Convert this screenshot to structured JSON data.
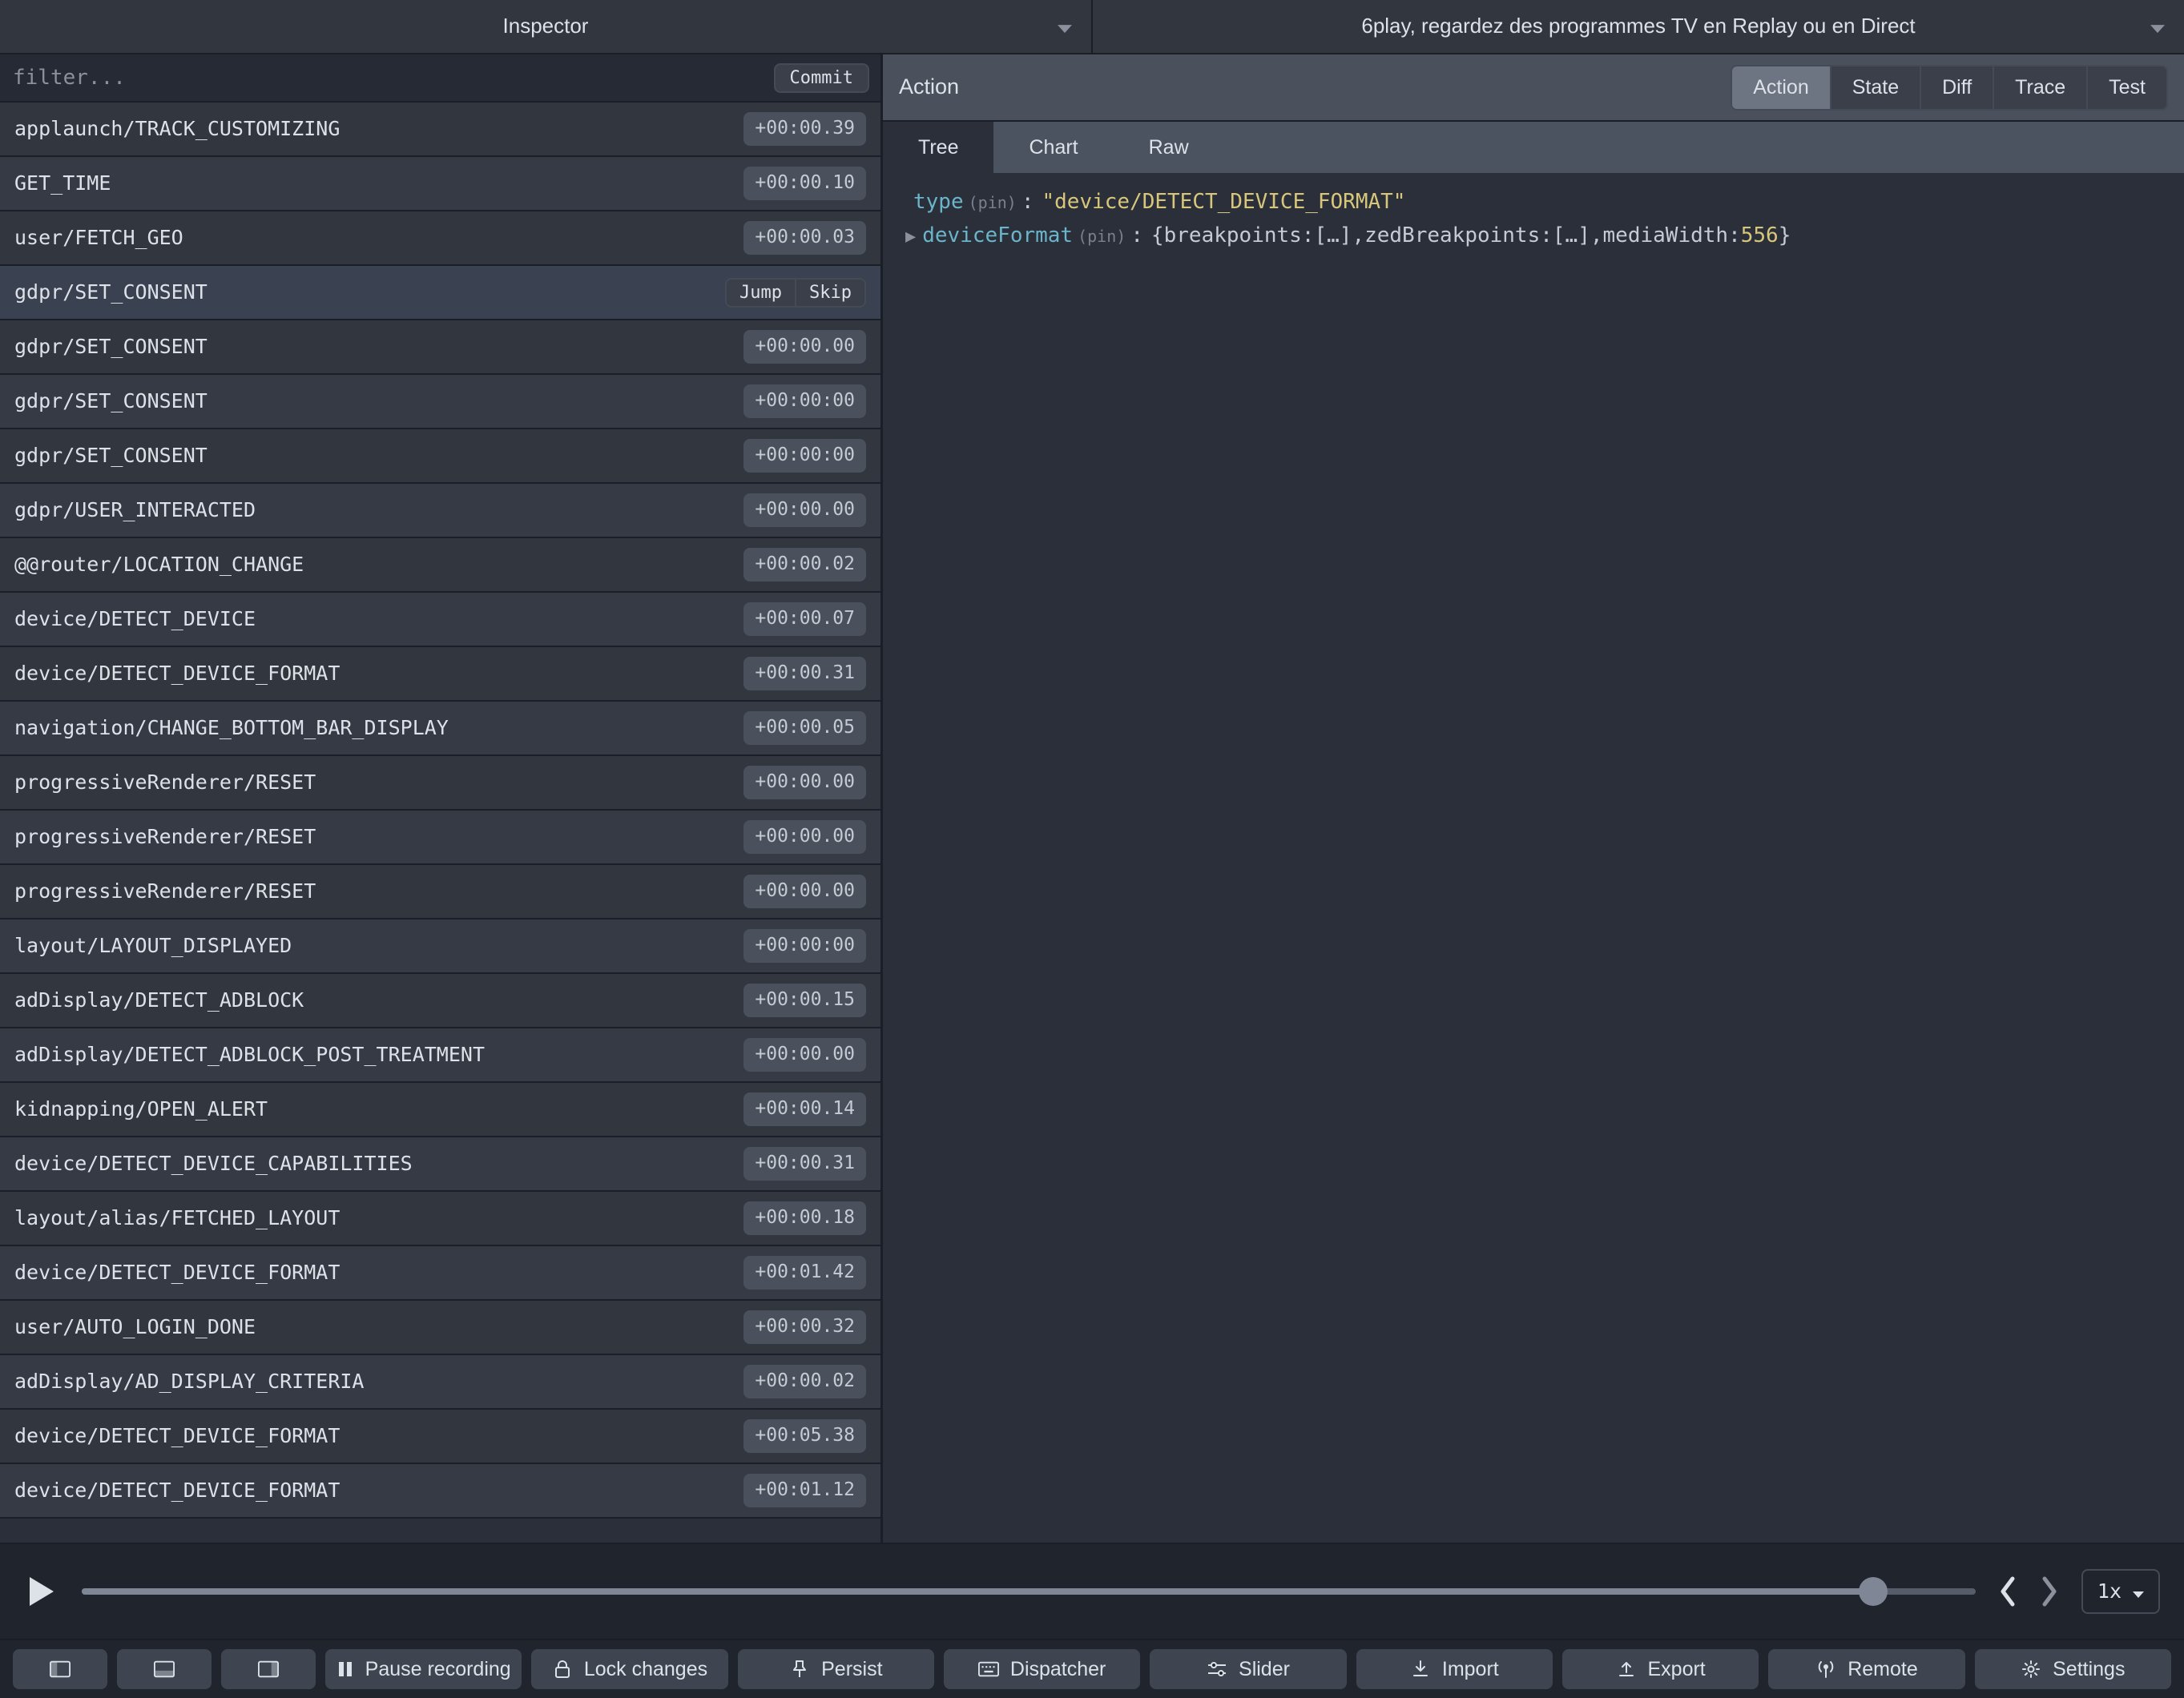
{
  "topTabs": {
    "left": "Inspector",
    "right": "6play, regardez des programmes TV en Replay ou en Direct"
  },
  "filter": {
    "placeholder": "filter...",
    "commitLabel": "Commit"
  },
  "selectedActionIndex": 3,
  "rowButtons": {
    "jump": "Jump",
    "skip": "Skip"
  },
  "actions": [
    {
      "name": "applaunch/TRACK_CUSTOMIZING",
      "time": "+00:00.39"
    },
    {
      "name": "GET_TIME",
      "time": "+00:00.10"
    },
    {
      "name": "user/FETCH_GEO",
      "time": "+00:00.03"
    },
    {
      "name": "gdpr/SET_CONSENT",
      "time": ""
    },
    {
      "name": "gdpr/SET_CONSENT",
      "time": "+00:00.00"
    },
    {
      "name": "gdpr/SET_CONSENT",
      "time": "+00:00:00"
    },
    {
      "name": "gdpr/SET_CONSENT",
      "time": "+00:00:00"
    },
    {
      "name": "gdpr/USER_INTERACTED",
      "time": "+00:00.00"
    },
    {
      "name": "@@router/LOCATION_CHANGE",
      "time": "+00:00.02"
    },
    {
      "name": "device/DETECT_DEVICE",
      "time": "+00:00.07"
    },
    {
      "name": "device/DETECT_DEVICE_FORMAT",
      "time": "+00:00.31"
    },
    {
      "name": "navigation/CHANGE_BOTTOM_BAR_DISPLAY",
      "time": "+00:00.05"
    },
    {
      "name": "progressiveRenderer/RESET",
      "time": "+00:00.00"
    },
    {
      "name": "progressiveRenderer/RESET",
      "time": "+00:00.00"
    },
    {
      "name": "progressiveRenderer/RESET",
      "time": "+00:00.00"
    },
    {
      "name": "layout/LAYOUT_DISPLAYED",
      "time": "+00:00:00"
    },
    {
      "name": "adDisplay/DETECT_ADBLOCK",
      "time": "+00:00.15"
    },
    {
      "name": "adDisplay/DETECT_ADBLOCK_POST_TREATMENT",
      "time": "+00:00.00"
    },
    {
      "name": "kidnapping/OPEN_ALERT",
      "time": "+00:00.14"
    },
    {
      "name": "device/DETECT_DEVICE_CAPABILITIES",
      "time": "+00:00.31"
    },
    {
      "name": "layout/alias/FETCHED_LAYOUT",
      "time": "+00:00.18"
    },
    {
      "name": "device/DETECT_DEVICE_FORMAT",
      "time": "+00:01.42"
    },
    {
      "name": "user/AUTO_LOGIN_DONE",
      "time": "+00:00.32"
    },
    {
      "name": "adDisplay/AD_DISPLAY_CRITERIA",
      "time": "+00:00.02"
    },
    {
      "name": "device/DETECT_DEVICE_FORMAT",
      "time": "+00:05.38"
    },
    {
      "name": "device/DETECT_DEVICE_FORMAT",
      "time": "+00:01.12"
    }
  ],
  "rightHeader": {
    "title": "Action",
    "tabs": [
      "Action",
      "State",
      "Diff",
      "Trace",
      "Test"
    ],
    "activeTab": 0
  },
  "subtabs": {
    "items": [
      "Tree",
      "Chart",
      "Raw"
    ],
    "active": 0
  },
  "tree": {
    "pinLabel": "(pin)",
    "rows": [
      {
        "key": "type",
        "value": "\"device/DETECT_DEVICE_FORMAT\"",
        "kind": "string",
        "expandable": false
      },
      {
        "key": "deviceFormat",
        "k1": "breakpoints",
        "v1": "[…]",
        "k2": "zedBreakpoints",
        "v2": "[…]",
        "k3": "mediaWidth",
        "v3": "556",
        "expandable": true
      }
    ]
  },
  "playback": {
    "speed": "1x",
    "progressPct": 94.6
  },
  "bottombar": {
    "pause": "Pause recording",
    "lock": "Lock changes",
    "persist": "Persist",
    "dispatcher": "Dispatcher",
    "slider": "Slider",
    "import": "Import",
    "export": "Export",
    "remote": "Remote",
    "settings": "Settings"
  }
}
